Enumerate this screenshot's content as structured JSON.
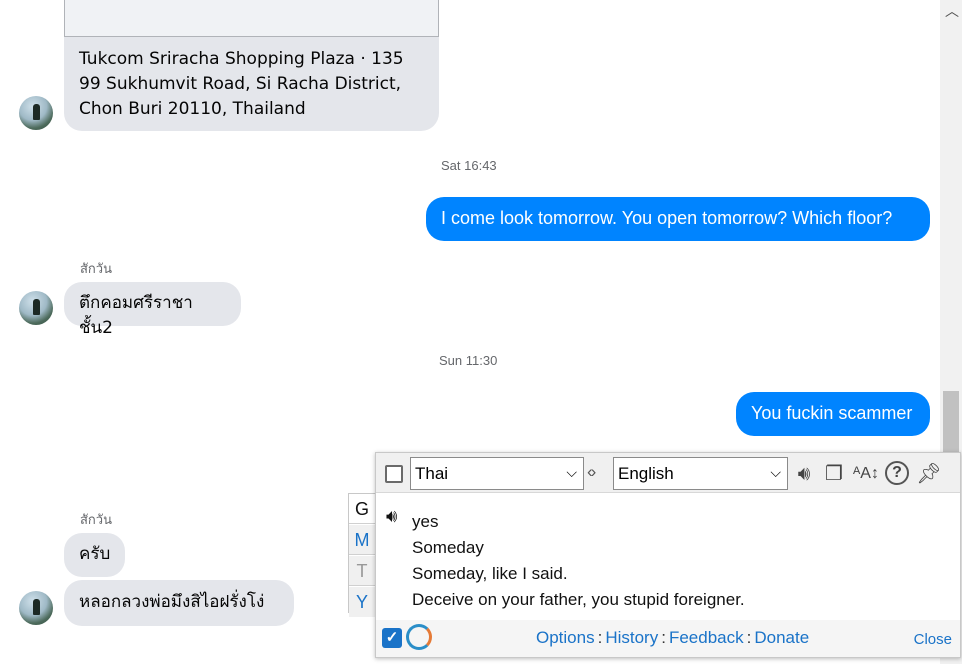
{
  "chat": {
    "location_card": "Tukcom Sriracha Shopping Plaza · 135 99 Sukhumvit Road, Si Racha District, Chon Buri 20110, Thailand",
    "timestamp_1": "Sat 16:43",
    "sent_message_1": "I come look tomorrow. You open tomorrow? Which floor?",
    "sender_name_1": "สักวัน",
    "received_message_1": "ตึกคอมศรีราชาชั้น2",
    "timestamp_2": "Sun 11:30",
    "sent_message_2": "You fuckin scammer",
    "sender_name_2": "สักวัน",
    "received_message_2": "ครับ",
    "received_message_3": "หลอกลวงพ่อมึงสิไอฝรั่งโง่"
  },
  "translator": {
    "source_language": "Thai",
    "target_language": "English",
    "tabs": [
      "G",
      "M",
      "T",
      "Y"
    ],
    "results": [
      "yes",
      "Someday",
      "Someday, like I said.",
      "Deceive on your father, you stupid foreigner."
    ],
    "footer": {
      "options": "Options",
      "history": "History",
      "feedback": "Feedback",
      "donate": "Donate",
      "close": "Close"
    },
    "colors": {
      "link": "#1a73c8",
      "accent": "#0084ff"
    }
  }
}
